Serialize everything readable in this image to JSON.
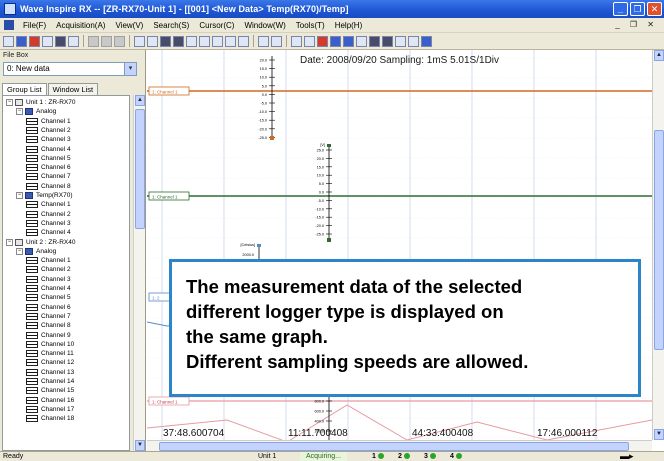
{
  "window": {
    "title": "Wave Inspire RX -- [ZR-RX70-Unit 1] - [[001] <New Data> Temp(RX70)/Temp]",
    "buttons": [
      "_",
      "❐",
      "✕"
    ]
  },
  "menubar": {
    "items": [
      "File(F)",
      "Acquisition(A)",
      "View(V)",
      "Search(S)",
      "Cursor(C)",
      "Window(W)",
      "Tools(T)",
      "Help(H)"
    ],
    "mdi_controls": "_ ❐ ✕"
  },
  "left_panel": {
    "filebox_label": "File Box",
    "filebox_value": "0: New data",
    "dropdown_glyph": "▾",
    "tabs": [
      "Group List",
      "Window List"
    ],
    "tree": [
      {
        "level": 0,
        "kind": "unit",
        "label": "Unit 1 : ZR-RX70",
        "expander": "−"
      },
      {
        "level": 1,
        "kind": "folder",
        "label": "Analog",
        "expander": "−"
      },
      {
        "level": 2,
        "kind": "ch",
        "label": "Channel 1"
      },
      {
        "level": 2,
        "kind": "ch",
        "label": "Channel 2"
      },
      {
        "level": 2,
        "kind": "ch",
        "label": "Channel 3"
      },
      {
        "level": 2,
        "kind": "ch",
        "label": "Channel 4"
      },
      {
        "level": 2,
        "kind": "ch",
        "label": "Channel 5"
      },
      {
        "level": 2,
        "kind": "ch",
        "label": "Channel 6"
      },
      {
        "level": 2,
        "kind": "ch",
        "label": "Channel 7"
      },
      {
        "level": 2,
        "kind": "ch",
        "label": "Channel 8"
      },
      {
        "level": 1,
        "kind": "folder",
        "label": "Temp(RX70)",
        "expander": "−"
      },
      {
        "level": 2,
        "kind": "ch",
        "label": "Channel 1"
      },
      {
        "level": 2,
        "kind": "ch",
        "label": "Channel 2"
      },
      {
        "level": 2,
        "kind": "ch",
        "label": "Channel 3"
      },
      {
        "level": 2,
        "kind": "ch",
        "label": "Channel 4"
      },
      {
        "level": 0,
        "kind": "unit",
        "label": "Unit 2 : ZR-RX40",
        "expander": "−"
      },
      {
        "level": 1,
        "kind": "folder",
        "label": "Analog",
        "expander": "−"
      },
      {
        "level": 2,
        "kind": "ch",
        "label": "Channel 1"
      },
      {
        "level": 2,
        "kind": "ch",
        "label": "Channel 2"
      },
      {
        "level": 2,
        "kind": "ch",
        "label": "Channel 3"
      },
      {
        "level": 2,
        "kind": "ch",
        "label": "Channel 4"
      },
      {
        "level": 2,
        "kind": "ch",
        "label": "Channel 5"
      },
      {
        "level": 2,
        "kind": "ch",
        "label": "Channel 6"
      },
      {
        "level": 2,
        "kind": "ch",
        "label": "Channel 7"
      },
      {
        "level": 2,
        "kind": "ch",
        "label": "Channel 8"
      },
      {
        "level": 2,
        "kind": "ch",
        "label": "Channel 9"
      },
      {
        "level": 2,
        "kind": "ch",
        "label": "Channel 10"
      },
      {
        "level": 2,
        "kind": "ch",
        "label": "Channel 11"
      },
      {
        "level": 2,
        "kind": "ch",
        "label": "Channel 12"
      },
      {
        "level": 2,
        "kind": "ch",
        "label": "Channel 13"
      },
      {
        "level": 2,
        "kind": "ch",
        "label": "Channel 14"
      },
      {
        "level": 2,
        "kind": "ch",
        "label": "Channel 15"
      },
      {
        "level": 2,
        "kind": "ch",
        "label": "Channel 16"
      },
      {
        "level": 2,
        "kind": "ch",
        "label": "Channel 17"
      },
      {
        "level": 2,
        "kind": "ch",
        "label": "Channel 18"
      }
    ]
  },
  "graph": {
    "header": "Date: 2008/09/20   Sampling: 1mS  5.01S/1Div",
    "scale1_ticks": [
      "20.0",
      "15.0",
      "10.0",
      "5.0",
      "0.0",
      "-5.0",
      "-10.0",
      "-15.0",
      "-20.0",
      "-25.0"
    ],
    "scale2_header": "[V]",
    "scale2_ticks": [
      "25.0",
      "20.0",
      "15.0",
      "10.0",
      "5.0",
      "0.0",
      "-5.0",
      "-10.0",
      "-15.0",
      "-20.0",
      "-25.0"
    ],
    "scale3_header": "[Celsius]",
    "scale3_top": "2000.0",
    "scale4_ticks": [
      "800.0",
      "600.0",
      "400.0",
      "200.0"
    ],
    "time_labels": [
      "37:48.600704",
      "11:11.700408",
      "44:33.400408",
      "17:46.000112"
    ],
    "channel_tags": [
      "1: Channel 1",
      "1: Channel 1",
      "1: 2",
      "1: Channel 1"
    ],
    "colors": {
      "orange": "#d2691e",
      "green": "#2e6b2e",
      "grid": "#c9d4e8",
      "pink": "#e79aa0",
      "blue_line": "#5b86c8"
    }
  },
  "callout": {
    "lines": [
      "The measurement data of the selected",
      "different logger type is displayed on",
      "the same graph.",
      "Different sampling speeds are allowed."
    ],
    "border_color": "#2a86c8"
  },
  "statusbar": {
    "ready": "Ready",
    "unit": "Unit 1",
    "state": "Acquiring...",
    "channels": [
      "1",
      "2",
      "3",
      "4"
    ]
  }
}
